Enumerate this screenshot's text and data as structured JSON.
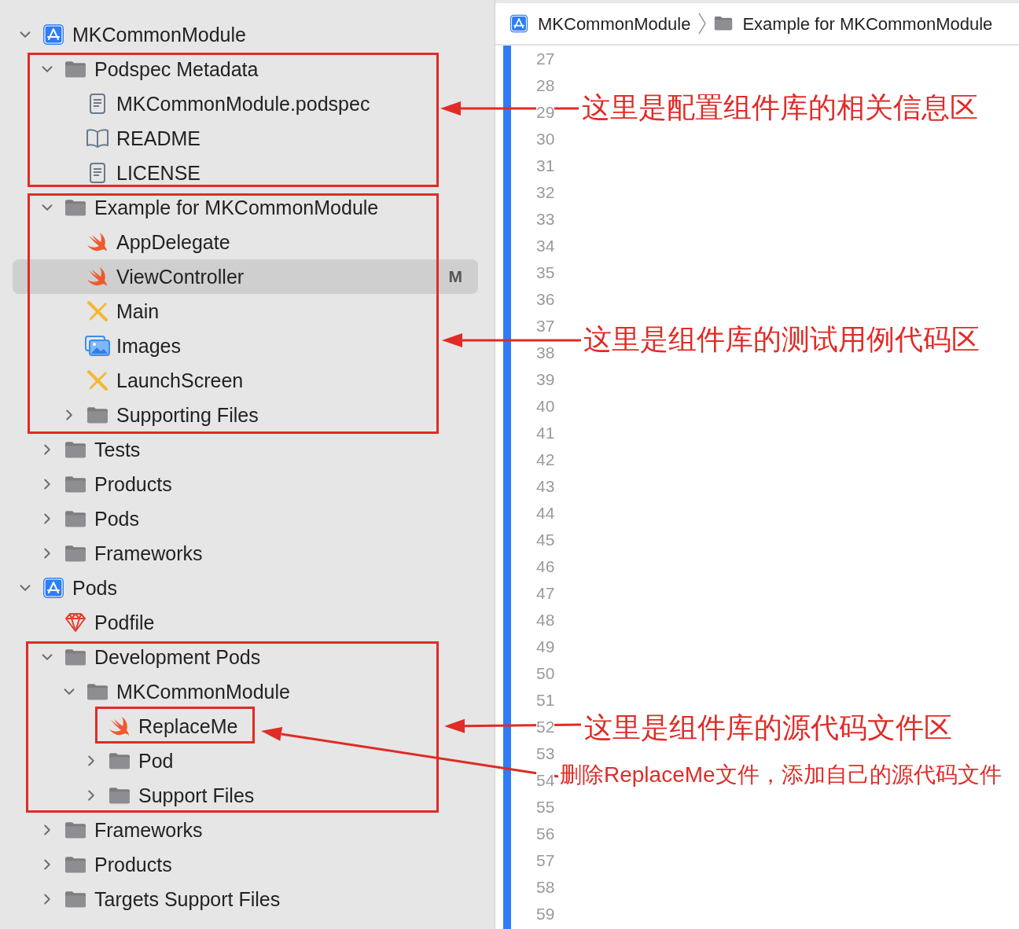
{
  "navigator": {
    "tree": [
      {
        "label": "MKCommonModule",
        "kind": "app",
        "expanded": true,
        "selected": false,
        "children": [
          {
            "label": "Podspec Metadata",
            "kind": "folder",
            "expanded": true,
            "selected": false,
            "children": [
              {
                "label": "MKCommonModule.podspec",
                "kind": "doc",
                "selected": false
              },
              {
                "label": "README",
                "kind": "book",
                "selected": false
              },
              {
                "label": "LICENSE",
                "kind": "doc",
                "selected": false
              }
            ]
          },
          {
            "label": "Example for MKCommonModule",
            "kind": "folder",
            "expanded": true,
            "selected": false,
            "children": [
              {
                "label": "AppDelegate",
                "kind": "swift",
                "selected": false
              },
              {
                "label": "ViewController",
                "kind": "swift",
                "selected": true,
                "badge": "M"
              },
              {
                "label": "Main",
                "kind": "storyboard",
                "selected": false
              },
              {
                "label": "Images",
                "kind": "images",
                "selected": false
              },
              {
                "label": "LaunchScreen",
                "kind": "storyboard",
                "selected": false
              },
              {
                "label": "Supporting Files",
                "kind": "folder",
                "expanded": false,
                "selected": false
              }
            ]
          },
          {
            "label": "Tests",
            "kind": "folder",
            "expanded": false,
            "selected": false
          },
          {
            "label": "Products",
            "kind": "folder",
            "expanded": false,
            "selected": false
          },
          {
            "label": "Pods",
            "kind": "folder",
            "expanded": false,
            "selected": false
          },
          {
            "label": "Frameworks",
            "kind": "folder",
            "expanded": false,
            "selected": false
          }
        ]
      },
      {
        "label": "Pods",
        "kind": "app",
        "expanded": true,
        "selected": false,
        "children": [
          {
            "label": "Podfile",
            "kind": "gem",
            "selected": false
          },
          {
            "label": "Development Pods",
            "kind": "folder",
            "expanded": true,
            "selected": false,
            "children": [
              {
                "label": "MKCommonModule",
                "kind": "folder",
                "expanded": true,
                "selected": false,
                "children": [
                  {
                    "label": "ReplaceMe",
                    "kind": "swift",
                    "selected": false
                  },
                  {
                    "label": "Pod",
                    "kind": "folder",
                    "expanded": false,
                    "selected": false
                  },
                  {
                    "label": "Support Files",
                    "kind": "folder",
                    "expanded": false,
                    "selected": false
                  }
                ]
              }
            ]
          },
          {
            "label": "Frameworks",
            "kind": "folder",
            "expanded": false,
            "selected": false
          },
          {
            "label": "Products",
            "kind": "folder",
            "expanded": false,
            "selected": false
          },
          {
            "label": "Targets Support Files",
            "kind": "folder",
            "expanded": false,
            "selected": false
          }
        ]
      }
    ]
  },
  "editor": {
    "breadcrumb": [
      {
        "label": "MKCommonModule",
        "kind": "app"
      },
      {
        "label": "Example for MKCommonModule",
        "kind": "folder"
      }
    ],
    "line_numbers": [
      "27",
      "28",
      "29",
      "30",
      "31",
      "32",
      "33",
      "34",
      "35",
      "36",
      "37",
      "38",
      "39",
      "40",
      "41",
      "42",
      "43",
      "44",
      "45",
      "46",
      "47",
      "48",
      "49",
      "50",
      "51",
      "52",
      "53",
      "54",
      "55",
      "56",
      "57",
      "58",
      "59"
    ]
  },
  "annotations": [
    {
      "text": "这里是配置组件库的相关信息区"
    },
    {
      "text": "这里是组件库的测试用例代码区"
    },
    {
      "text": "这里是组件库的源代码文件区"
    },
    {
      "text": "删除ReplaceMe文件，添加自己的源代码文件"
    }
  ]
}
